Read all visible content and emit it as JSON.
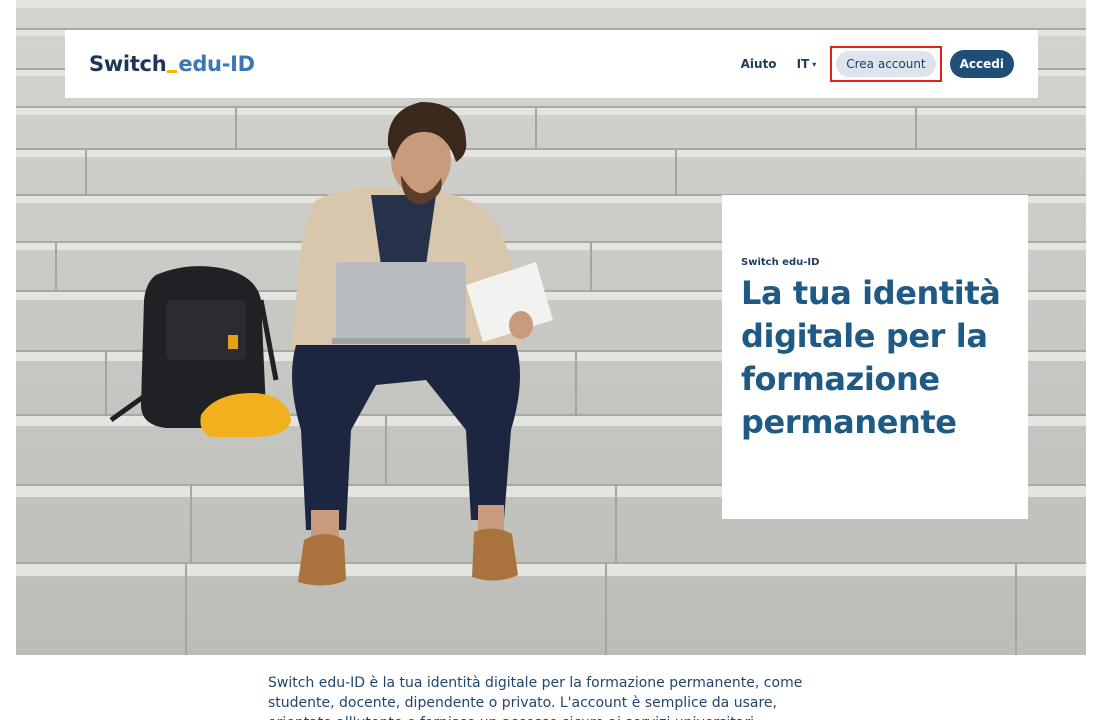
{
  "header": {
    "logo_part1": "Switch",
    "logo_part2": "edu-ID",
    "nav": {
      "help_label": "Aiuto",
      "language_label": "IT",
      "create_account_label": "Crea account",
      "login_label": "Accedi"
    }
  },
  "hero": {
    "eyebrow": "Switch edu-ID",
    "title": "La tua identità digitale per la formazione permanente"
  },
  "intro": {
    "text": "Switch edu-ID è la tua identità digitale per la formazione permanente, come studente, docente, dipendente o privato. L'account è semplice da usare, orientato all'utente e fornisce un accesso sicuro ai servizi universitari."
  },
  "colors": {
    "brand_dark": "#1d3557",
    "brand_blue": "#1f5a85",
    "accent_yellow": "#f4b400",
    "login_button": "#1f4f78",
    "create_button_bg": "#dde4ee",
    "highlight_red": "#e2231a"
  }
}
